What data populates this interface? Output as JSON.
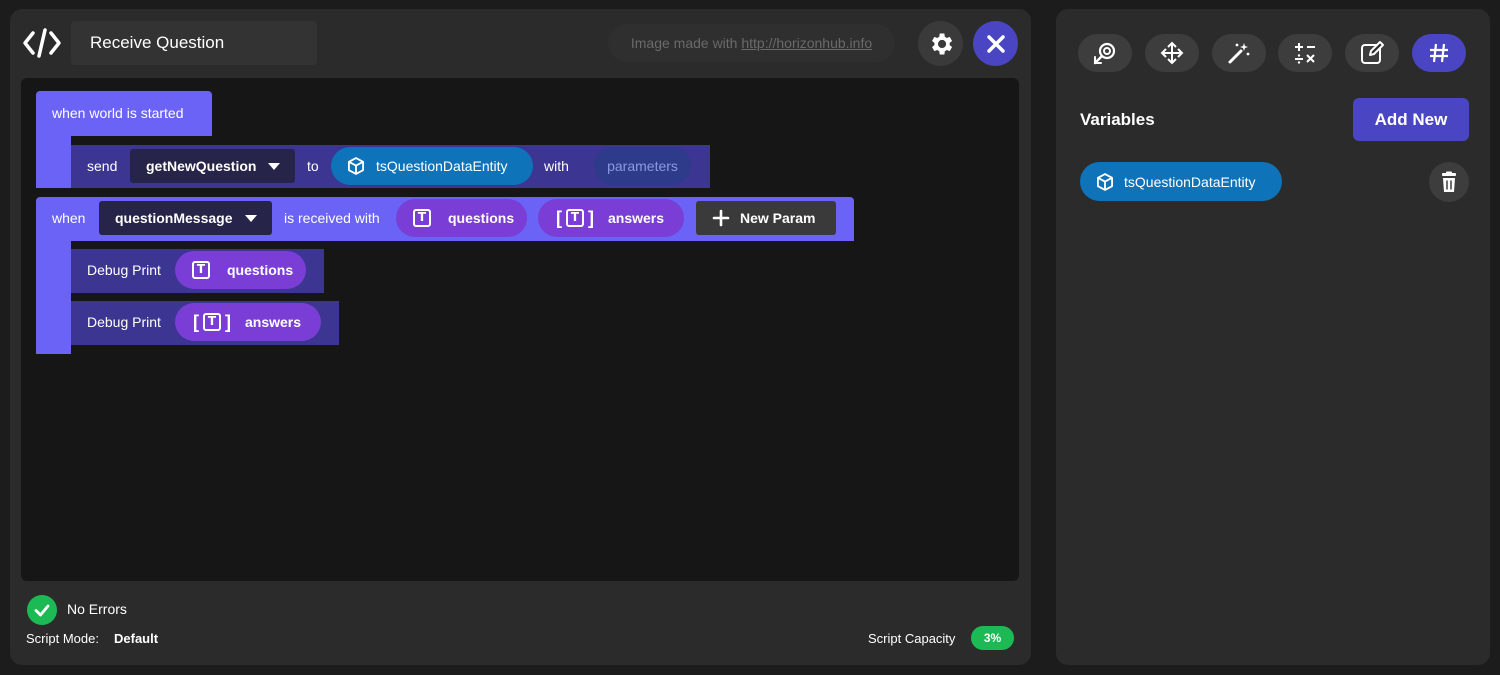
{
  "header": {
    "title": "Receive Question",
    "credit_prefix": "Image made with ",
    "credit_link": "http://horizonhub.info"
  },
  "icons": {
    "code": "code-icon",
    "settings": "gear-icon",
    "close": "close-icon",
    "entity": "cube-icon",
    "text_type": "text-type-icon",
    "add": "plus-icon",
    "status": "check-icon",
    "delete": "trash-icon"
  },
  "blocks": {
    "world_started": {
      "label": "when world is started",
      "send": {
        "label": "send",
        "event": "getNewQuestion",
        "to_label": "to",
        "target": "tsQuestionDataEntity",
        "with_label": "with",
        "params_placeholder": "parameters"
      }
    },
    "received": {
      "when_label": "when",
      "event": "questionMessage",
      "received_label": "is received with",
      "param1": "questions",
      "param2": "answers",
      "new_param": "New Param",
      "prints": [
        {
          "label": "Debug Print",
          "value": "questions"
        },
        {
          "label": "Debug Print",
          "value": "answers"
        }
      ]
    }
  },
  "status": {
    "errors": "No Errors",
    "mode_label": "Script Mode:",
    "mode_value": "Default",
    "capacity_label": "Script Capacity",
    "capacity_value": "3%"
  },
  "sidebar": {
    "tools": [
      "gizmo-icon",
      "move-icon",
      "magic-wand-icon",
      "math-ops-icon",
      "edit-icon",
      "hash-icon"
    ],
    "active_tool": "hash-icon",
    "variables_title": "Variables",
    "add_new": "Add New",
    "variables": [
      {
        "name": "tsQuestionDataEntity",
        "type": "entity"
      }
    ]
  },
  "colors": {
    "background": "#1c1c1c",
    "panel": "#2b2b2b",
    "canvas": "#161616",
    "accent": "#4a45c2",
    "block_event": "#6a63f6",
    "block_action": "#3c3591",
    "entity": "#0e73b8",
    "variable": "#7a3dd6",
    "success": "#1db954"
  }
}
